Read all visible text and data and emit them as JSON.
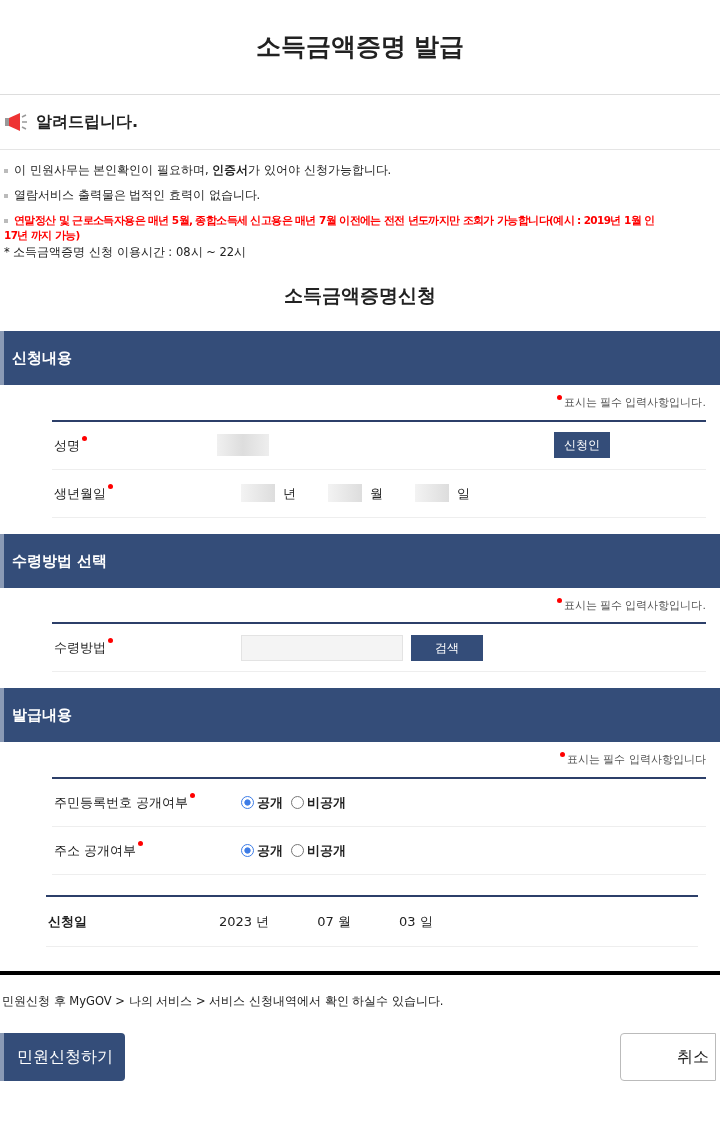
{
  "title": "소득금액증명 발급",
  "notice": {
    "heading": "알려드립니다.",
    "items": [
      {
        "kind": "bullet",
        "lines": [
          "이 민원사무는 본인확인이 필요하며, **인증서**가 있어야 신청가능합니다."
        ]
      },
      {
        "kind": "bullet",
        "lines": [
          "열람서비스 출력물은 법적인 효력이 없습니다."
        ]
      },
      {
        "kind": "warning",
        "lines": [
          "연말정산 및 근로소득자용은 매년 5월, 종합소득세 신고용은 매년 7월 이전에는 전전 년도까지만 조회가 가능합니다(예시 : 2019년 1월 인",
          "17년 까지 가능)"
        ]
      },
      {
        "kind": "plain",
        "lines": [
          "* 소득금액증명 신청 이용시간 : 08시 ~ 22시"
        ]
      }
    ]
  },
  "form_title": "소득금액증명신청",
  "sections": [
    {
      "title": "신청내용",
      "required_note": "표시는 필수 입력사항입니다.",
      "rows": [
        {
          "kind": "name",
          "label": "성명",
          "required": true,
          "button": "신청인"
        },
        {
          "kind": "date",
          "label": "생년월일",
          "required": true,
          "parts": [
            "년",
            "월",
            "일"
          ]
        }
      ]
    },
    {
      "title": "수령방법 선택",
      "required_note": "표시는 필수 입력사항입니다.",
      "rows": [
        {
          "kind": "search",
          "label": "수령방법",
          "required": true,
          "button": "검색"
        }
      ]
    },
    {
      "title": "발급내용",
      "required_note": "표시는 필수 입력사항입니다",
      "rows": [
        {
          "kind": "radio",
          "label": "주민등록번호 공개여부",
          "required": true,
          "options": [
            {
              "label": "공개",
              "selected": true
            },
            {
              "label": "비공개",
              "selected": false
            }
          ]
        },
        {
          "kind": "radio",
          "label": "주소 공개여부",
          "required": true,
          "options": [
            {
              "label": "공개",
              "selected": true
            },
            {
              "label": "비공개",
              "selected": false
            }
          ]
        }
      ]
    }
  ],
  "application_date": {
    "label": "신청일",
    "parts": [
      "2023 년",
      "07 월",
      "03 일"
    ]
  },
  "footer_note": "민원신청 후 MyGOV > 나의 서비스 > 서비스 신청내역에서 확인 하실수 있습니다.",
  "buttons": [
    {
      "kind": "primary",
      "label": "민원신청하기"
    },
    {
      "kind": "secondary",
      "label": "취소"
    }
  ]
}
